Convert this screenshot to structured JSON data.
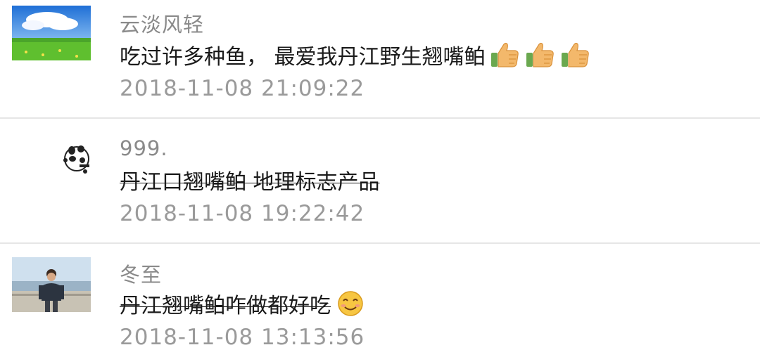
{
  "comments": [
    {
      "name": "云淡风轻",
      "text": "吃过许多种鱼， 最爱我丹江野生翘嘴鲌",
      "emojis": [
        "thumbs-up-icon",
        "thumbs-up-icon",
        "thumbs-up-icon"
      ],
      "time": "2018-11-08 21:09:22"
    },
    {
      "name": "999.",
      "text": "丹江口翘嘴鲌 地理标志产品",
      "emojis": [],
      "time": "2018-11-08 19:22:42"
    },
    {
      "name": "冬至",
      "text": "丹江翘嘴鲌咋做都好吃",
      "emojis": [
        "smile-face-icon"
      ],
      "time": "2018-11-08 13:13:56"
    }
  ],
  "colors": {
    "name": "#8a8a8a",
    "text": "#1a1a1a",
    "time": "#9a9a9a",
    "divider": "#e6e6e6"
  }
}
